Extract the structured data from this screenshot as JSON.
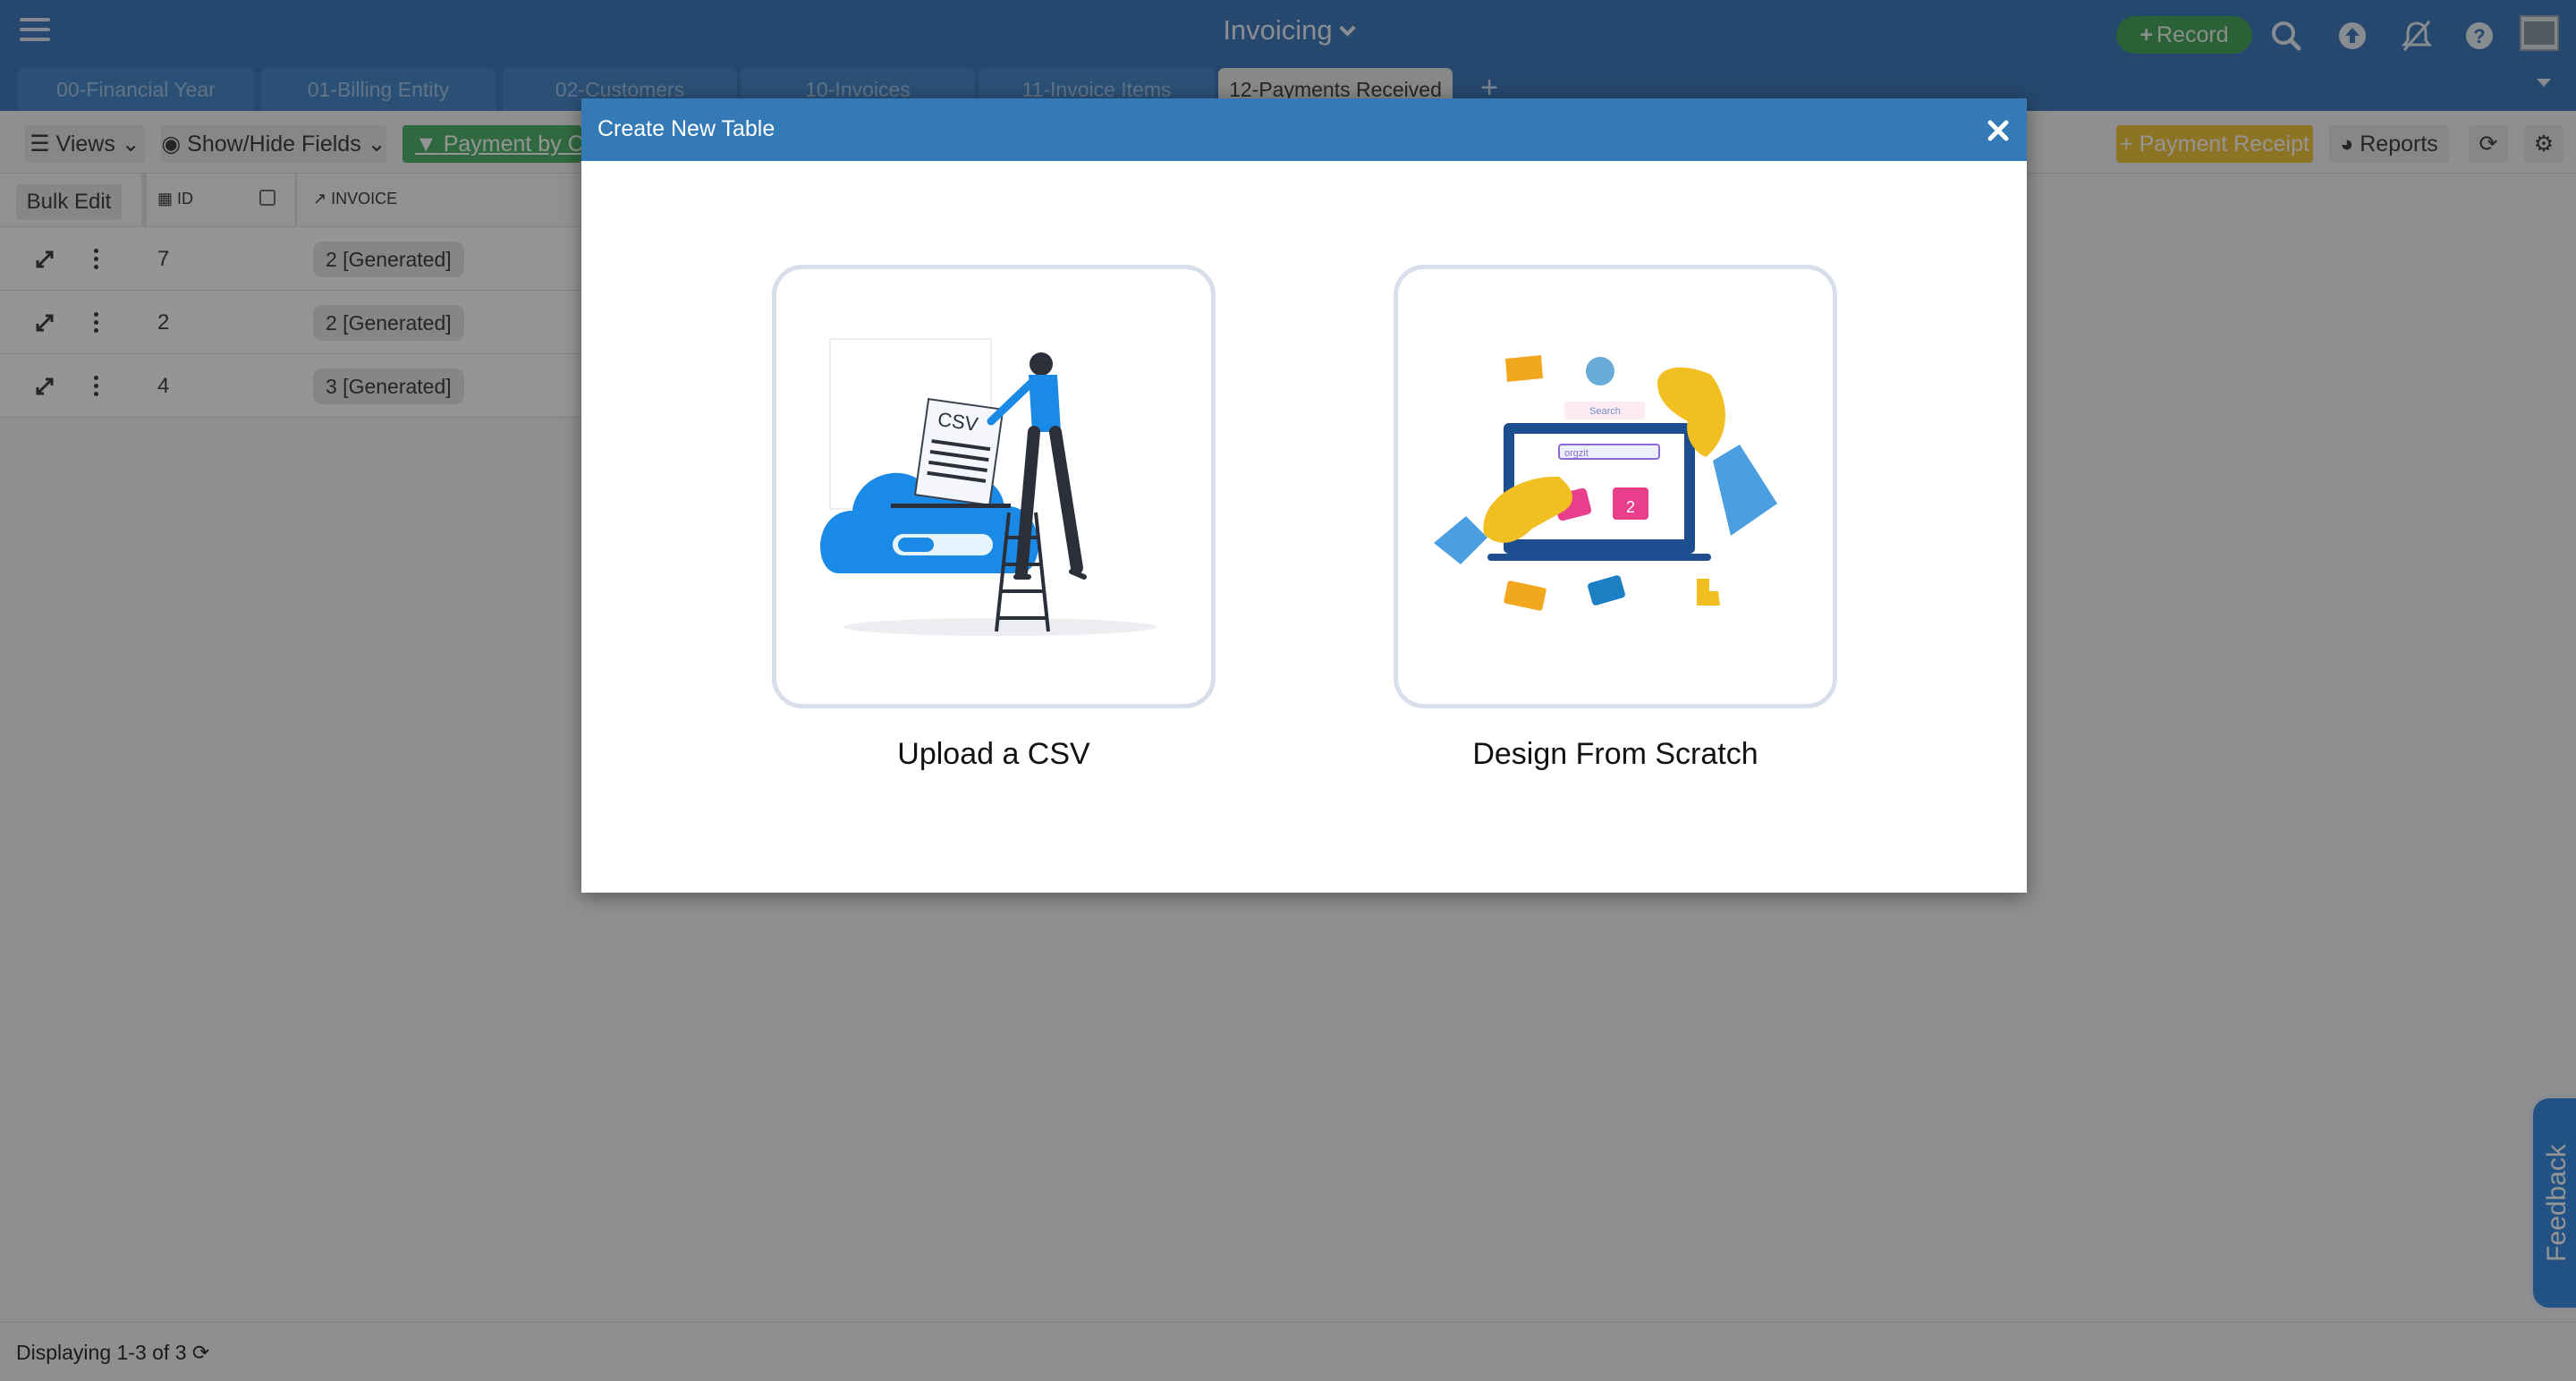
{
  "app": {
    "title": "Invoicing",
    "record_label": "Record"
  },
  "tabs": [
    {
      "label": "00-Financial Year"
    },
    {
      "label": "01-Billing Entity"
    },
    {
      "label": "02-Customers"
    },
    {
      "label": "10-Invoices"
    },
    {
      "label": "11-Invoice Items"
    },
    {
      "label": "12-Payments Received",
      "active": true
    }
  ],
  "toolbar": {
    "views_label": "Views",
    "show_hide_label": "Show/Hide Fields",
    "filter_label": "Payment by Cash",
    "payment_receipt_label": "Payment Receipt",
    "reports_label": "Reports"
  },
  "grid": {
    "bulk_edit_label": "Bulk Edit",
    "columns": [
      "ID",
      "INVOICE"
    ],
    "rows": [
      {
        "id": "7",
        "invoice": "2 [Generated]"
      },
      {
        "id": "2",
        "invoice": "2 [Generated]"
      },
      {
        "id": "4",
        "invoice": "3 [Generated]"
      }
    ]
  },
  "status": {
    "text": "Displaying 1-3 of 3"
  },
  "feedback_label": "Feedback",
  "modal": {
    "title": "Create New Table",
    "options": [
      {
        "label": "Upload a CSV",
        "illustration": "csv-upload"
      },
      {
        "label": "Design From Scratch",
        "illustration": "design-scratch"
      }
    ],
    "illustration_text": {
      "csv": "CSV",
      "search": "Search",
      "brand": "orgzit",
      "calendar_day": "2"
    }
  },
  "colors": {
    "topbar": "#3574b9",
    "modal_header": "#337ab7",
    "record_green": "#3da153",
    "filter_green": "#48b063",
    "receipt_yellow": "#f1c232",
    "feedback_blue": "#2e86de"
  }
}
